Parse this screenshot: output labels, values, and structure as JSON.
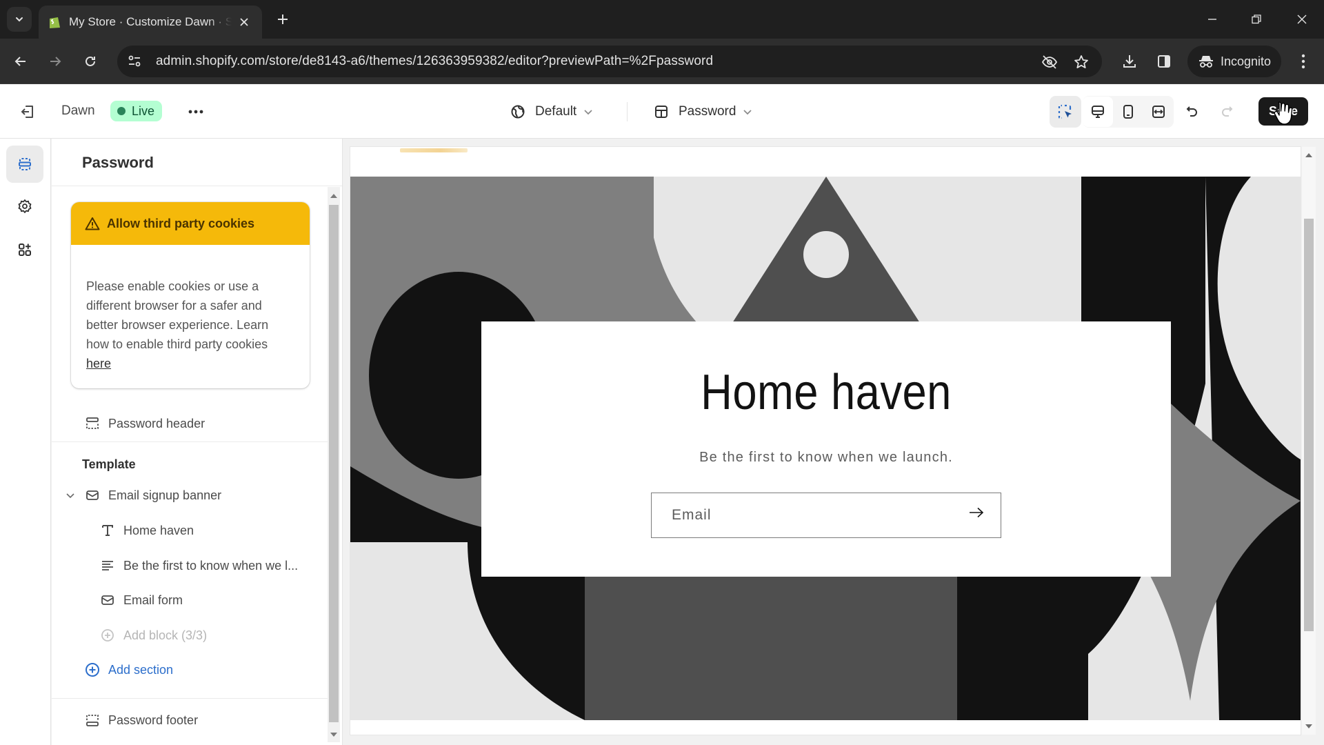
{
  "browser": {
    "tab": {
      "title": "My Store · Customize Dawn · Shopify",
      "favicon": "shopify-bag-icon"
    },
    "url": "admin.shopify.com/store/de8143-a6/themes/126363959382/editor?previewPath=%2Fpassword",
    "profile_label": "Incognito",
    "icons": [
      "tab-search-icon",
      "close-icon",
      "plus-icon",
      "minimize-icon",
      "restore-icon",
      "close-window-icon",
      "back-icon",
      "forward-icon",
      "reload-icon",
      "site-info-icon",
      "eye-off-icon",
      "star-icon",
      "download-icon",
      "side-panel-icon",
      "incognito-icon",
      "more-vertical-icon"
    ]
  },
  "editor": {
    "theme_name": "Dawn",
    "status_badge": "Live",
    "status_color": "#b4fed2",
    "theme_dropdown": "Default",
    "page_dropdown": "Password",
    "save_label": "Save",
    "toolbar_icons": [
      "inspector-icon",
      "desktop-icon",
      "mobile-icon",
      "fullwidth-icon",
      "undo-icon",
      "redo-icon"
    ]
  },
  "rail": {
    "items": [
      {
        "name": "sections",
        "icon": "sections-icon",
        "active": true
      },
      {
        "name": "theme-settings",
        "icon": "gear-icon",
        "active": false
      },
      {
        "name": "app-embeds",
        "icon": "apps-icon",
        "active": false
      }
    ]
  },
  "sidebar": {
    "title": "Password",
    "cookie_banner": {
      "title": "Allow third party cookies",
      "body": "Please enable cookies or use a different browser for a safer and better browser experience. Learn how to enable third party cookies ",
      "link": "here",
      "accent": "#f5b90a"
    },
    "header_section": "Password header",
    "template_heading": "Template",
    "section": {
      "label": "Email signup banner",
      "expanded": true,
      "blocks": [
        {
          "label": "Home haven",
          "icon": "heading-icon"
        },
        {
          "label": "Be the first to know when we l...",
          "icon": "text-icon"
        },
        {
          "label": "Email form",
          "icon": "email-icon"
        }
      ],
      "add_block": "Add block (3/3)"
    },
    "add_section": "Add section",
    "footer_section": "Password footer"
  },
  "preview": {
    "heading": "Home haven",
    "subheading": "Be the first to know when we launch.",
    "email_placeholder": "Email",
    "email_value": ""
  }
}
